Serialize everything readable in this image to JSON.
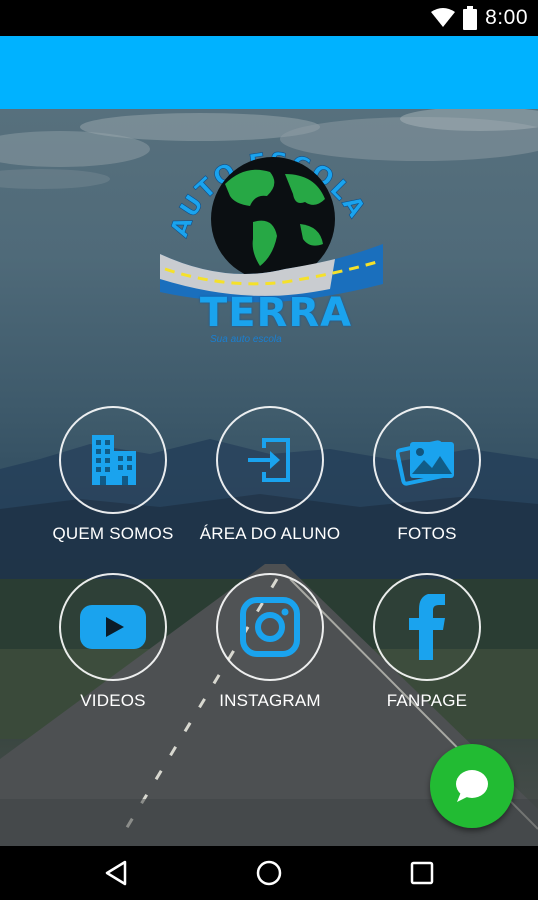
{
  "status_bar": {
    "time": "8:00",
    "icons": [
      "wifi-icon",
      "battery-icon"
    ]
  },
  "app_bar": {
    "color": "#00B2FF"
  },
  "logo": {
    "arc_text": "AUTO ESCOLA",
    "name": "TERRA",
    "tagline": "Sua auto escola"
  },
  "menu": [
    {
      "label": "QUEM SOMOS",
      "icon": "building-icon"
    },
    {
      "label": "ÁREA DO ALUNO",
      "icon": "login-icon"
    },
    {
      "label": "FOTOS",
      "icon": "photos-icon"
    },
    {
      "label": "VIDEOS",
      "icon": "youtube-icon"
    },
    {
      "label": "INSTAGRAM",
      "icon": "instagram-icon"
    },
    {
      "label": "FANPAGE",
      "icon": "facebook-icon"
    }
  ],
  "fab": {
    "icon": "chat-icon",
    "color": "#22BB33"
  },
  "accent_color": "#1AA3EE",
  "nav_bar": {
    "buttons": [
      "back-icon",
      "home-icon",
      "recents-icon"
    ]
  }
}
